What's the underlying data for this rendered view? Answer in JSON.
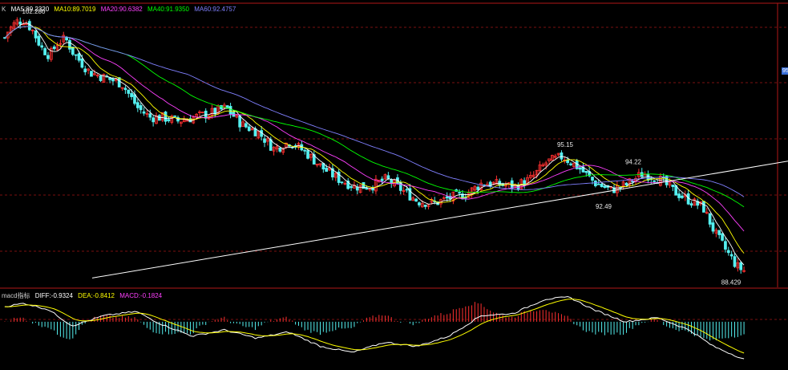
{
  "main_legend": {
    "prefix": "K",
    "items": [
      {
        "label": "MA5:89.2320",
        "color": "#ffffff"
      },
      {
        "label": "MA10:89.7019",
        "color": "#ffff00"
      },
      {
        "label": "MA20:90.6382",
        "color": "#ff40ff"
      },
      {
        "label": "MA40:91.9350",
        "color": "#00ff00"
      },
      {
        "label": "MA60:92.4757",
        "color": "#8080ff"
      }
    ]
  },
  "macd_legend": {
    "items": [
      {
        "label": "macd指标",
        "color": "#cccccc"
      },
      {
        "label": "DIFF:-0.9324",
        "color": "#ffffff"
      },
      {
        "label": "DEA:-0.8412",
        "color": "#ffff00"
      },
      {
        "label": "MACD:-0.1824",
        "color": "#ff40ff"
      }
    ]
  },
  "right_badge": "95",
  "colors": {
    "up": "#ff3030",
    "down": "#54f0f0",
    "grid": "#7a1010",
    "divider": "#b01818",
    "trendline": "#ffffff",
    "ma5": "#ffffff",
    "ma10": "#ffff00",
    "ma20": "#ff40ff",
    "ma40": "#00ff00",
    "ma60": "#8080ff",
    "diff": "#ffffff",
    "dea": "#ffff00"
  },
  "chart_data": {
    "type": "candlestick",
    "ylim": [
      87.8,
      103.0
    ],
    "bar_count": 240,
    "anchors": [
      [
        0,
        100.8
      ],
      [
        8,
        101.5
      ],
      [
        18,
        102.0
      ],
      [
        28,
        102.1
      ],
      [
        38,
        101.6
      ],
      [
        50,
        100.6
      ],
      [
        60,
        100.2
      ],
      [
        70,
        100.9
      ],
      [
        80,
        101.1
      ],
      [
        90,
        100.3
      ],
      [
        110,
        99.3
      ],
      [
        130,
        99.0
      ],
      [
        150,
        98.7
      ],
      [
        170,
        97.4
      ],
      [
        185,
        96.9
      ],
      [
        200,
        96.9
      ],
      [
        220,
        96.7
      ],
      [
        240,
        96.9
      ],
      [
        260,
        97.1
      ],
      [
        280,
        97.4
      ],
      [
        300,
        96.5
      ],
      [
        320,
        96.1
      ],
      [
        340,
        95.2
      ],
      [
        360,
        95.6
      ],
      [
        380,
        95.0
      ],
      [
        400,
        94.2
      ],
      [
        420,
        93.6
      ],
      [
        440,
        93.2
      ],
      [
        460,
        93.2
      ],
      [
        480,
        93.6
      ],
      [
        500,
        93.0
      ],
      [
        520,
        92.4
      ],
      [
        540,
        92.3
      ],
      [
        560,
        92.6
      ],
      [
        580,
        92.8
      ],
      [
        600,
        93.4
      ],
      [
        620,
        93.3
      ],
      [
        640,
        93.2
      ],
      [
        660,
        93.6
      ],
      [
        680,
        94.5
      ],
      [
        700,
        94.8
      ],
      [
        720,
        94.2
      ],
      [
        740,
        93.4
      ],
      [
        760,
        93.0
      ],
      [
        780,
        93.3
      ],
      [
        800,
        93.9
      ],
      [
        820,
        93.6
      ],
      [
        840,
        92.9
      ],
      [
        860,
        92.4
      ],
      [
        875,
        92.1
      ],
      [
        890,
        90.7
      ],
      [
        905,
        89.7
      ],
      [
        918,
        88.9
      ],
      [
        930,
        88.6
      ]
    ],
    "peak_labels": [
      {
        "label": "102.280",
        "price": 102.28,
        "x_plot": 42,
        "side": "up"
      },
      {
        "label": "95.15",
        "price": 95.15,
        "x_plot": 705,
        "side": "up"
      },
      {
        "label": "94.22",
        "price": 94.22,
        "x_plot": 790,
        "side": "up"
      },
      {
        "label": "92.49",
        "price": 92.49,
        "x_plot": 753,
        "side": "down"
      },
      {
        "label": "88.429",
        "price": 88.429,
        "x_plot": 912,
        "side": "down"
      }
    ],
    "trendlines": [
      {
        "from": [
          115,
          88.3
        ],
        "to": [
          983,
          94.55
        ]
      }
    ],
    "macd_diff_anchors": [
      [
        0,
        0.35
      ],
      [
        30,
        0.45
      ],
      [
        60,
        0.3
      ],
      [
        90,
        -0.1
      ],
      [
        130,
        0.15
      ],
      [
        170,
        0.25
      ],
      [
        200,
        -0.05
      ],
      [
        240,
        -0.35
      ],
      [
        280,
        -0.2
      ],
      [
        320,
        -0.4
      ],
      [
        360,
        -0.25
      ],
      [
        400,
        -0.6
      ],
      [
        440,
        -0.75
      ],
      [
        480,
        -0.5
      ],
      [
        520,
        -0.6
      ],
      [
        560,
        -0.35
      ],
      [
        600,
        0.15
      ],
      [
        640,
        0.2
      ],
      [
        680,
        0.55
      ],
      [
        710,
        0.6
      ],
      [
        740,
        0.3
      ],
      [
        780,
        0.0
      ],
      [
        820,
        0.1
      ],
      [
        860,
        -0.2
      ],
      [
        890,
        -0.6
      ],
      [
        930,
        -0.93
      ]
    ],
    "macd_ylim": [
      -1.0,
      0.8
    ]
  }
}
